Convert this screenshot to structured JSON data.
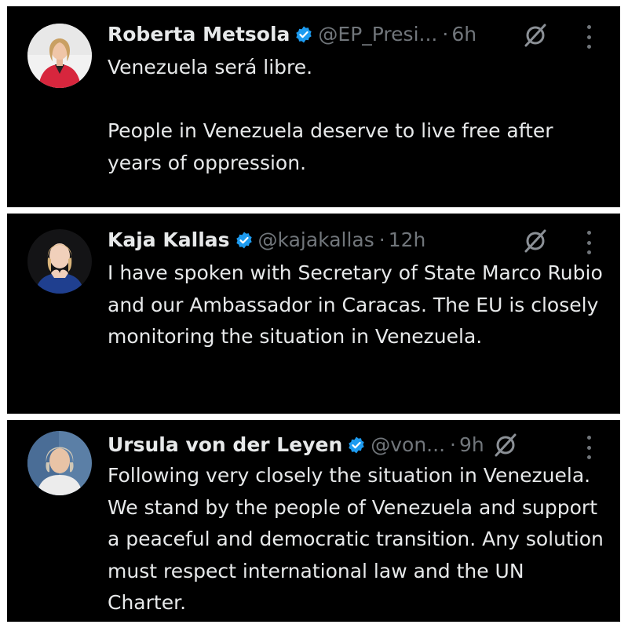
{
  "tweets": [
    {
      "name": "Roberta Metsola",
      "handle": "@EP_Presi...",
      "separator": "·",
      "time": "6h",
      "paragraphs": [
        "Venezuela será libre.",
        "People in Venezuela deserve to live free after years of oppression."
      ]
    },
    {
      "name": "Kaja Kallas",
      "handle": "@kajakallas",
      "separator": "·",
      "time": "12h",
      "paragraphs": [
        "I have spoken with Secretary of State Marco Rubio and our Ambassador in Caracas. The EU is closely monitoring the situation in Venezuela."
      ]
    },
    {
      "name": "Ursula von der Leyen",
      "handle": "@von...",
      "separator": "·",
      "time": "9h",
      "paragraphs": [
        "Following very closely the situation in Venezuela. We stand by the people of Venezuela and support a peaceful and democratic transition. Any solution must respect international law and the UN Charter."
      ]
    }
  ],
  "icons": {
    "verified": "verified-badge-icon",
    "grok": "grok-icon",
    "more": "more-options-icon",
    "avatar": "avatar"
  },
  "colors": {
    "background": "#000000",
    "text": "#e7e9ea",
    "secondary_text": "#71767b",
    "verified_blue": "#1d9bf0",
    "frame": "#ffffff"
  }
}
